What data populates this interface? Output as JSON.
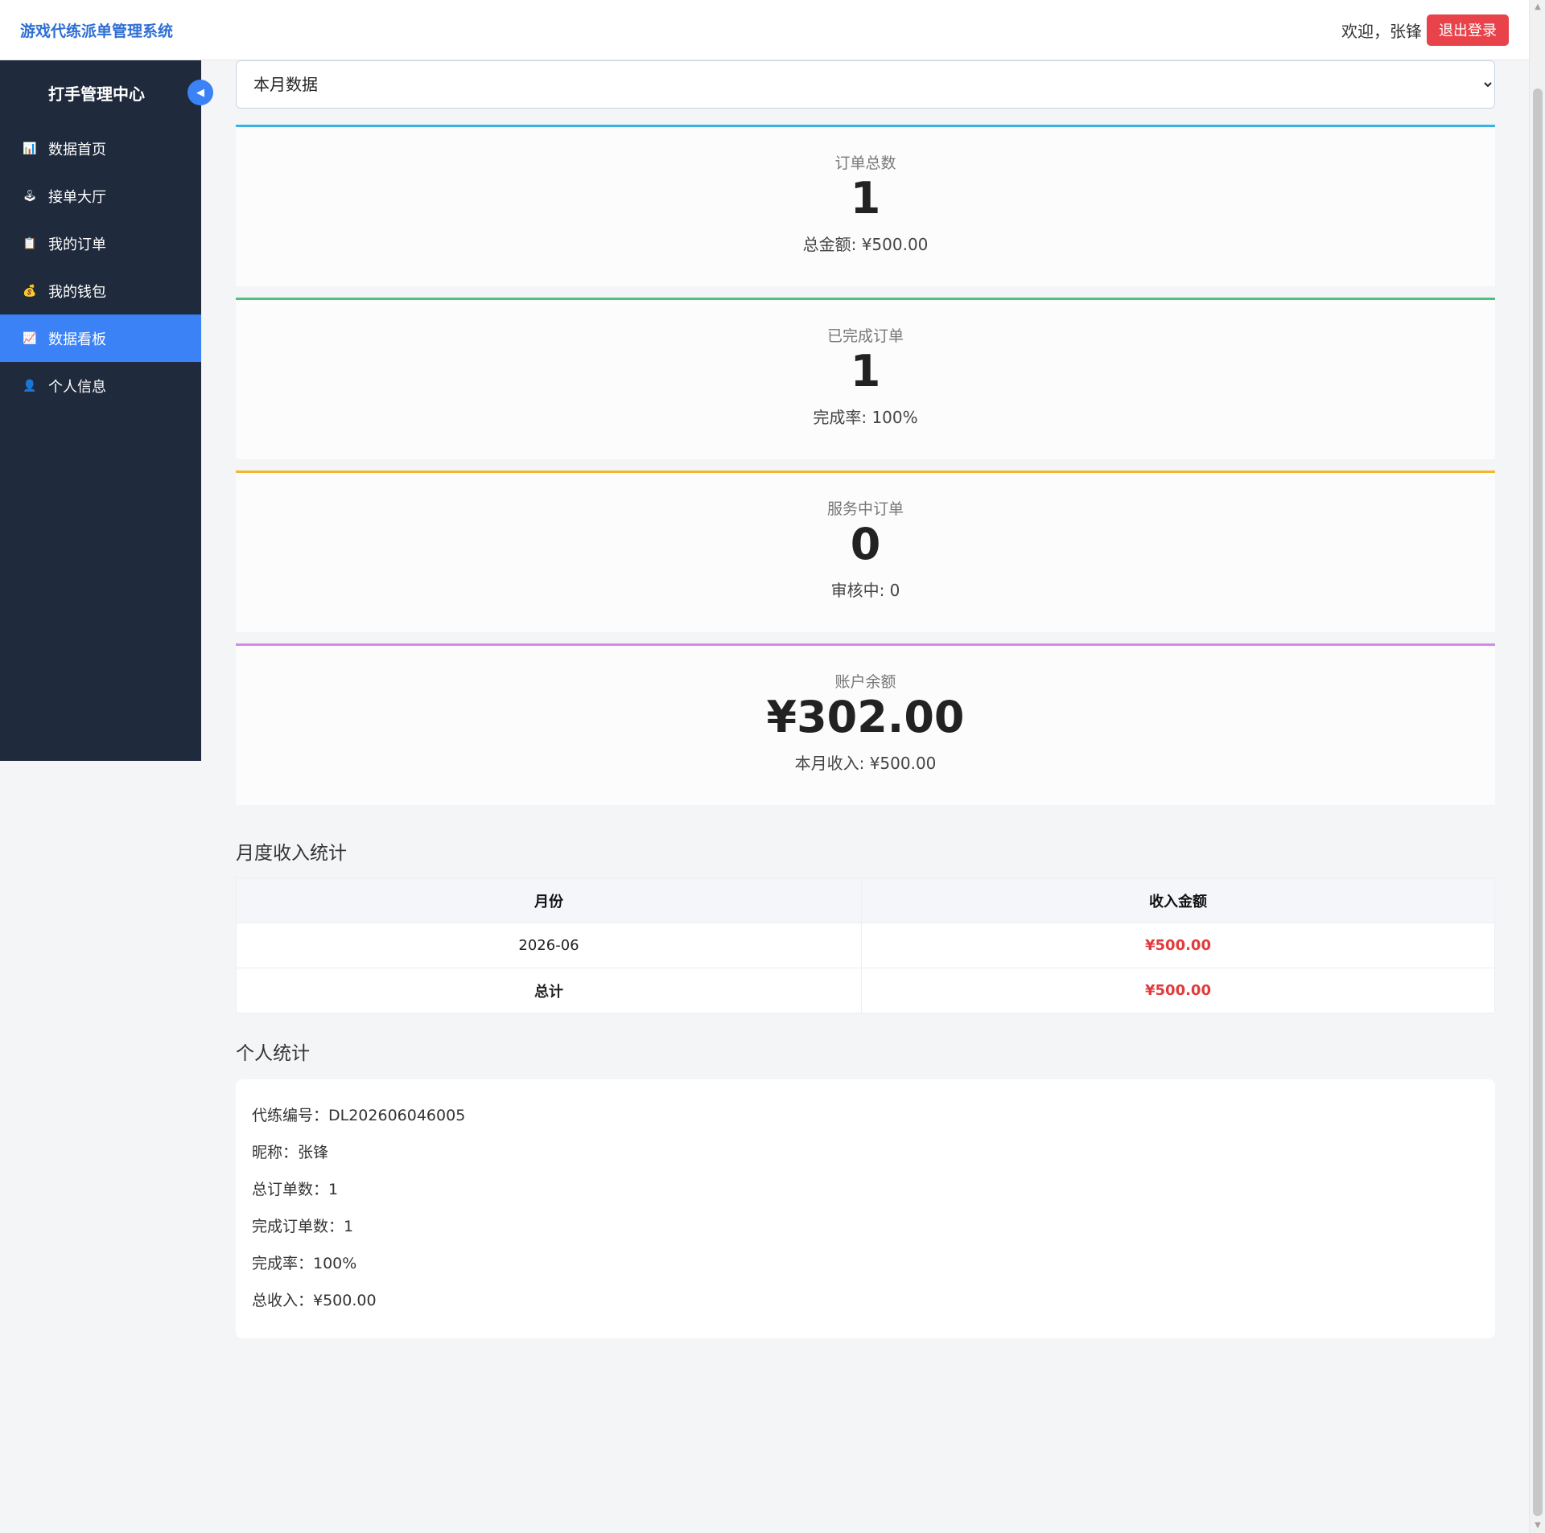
{
  "header": {
    "brand": "游戏代练派单管理系统",
    "welcome": "欢迎，张锋",
    "logout": "退出登录"
  },
  "sidebar": {
    "title": "打手管理中心",
    "collapse_icon": "◀",
    "items": [
      {
        "label": "数据首页",
        "icon": "bar-chart-icon",
        "glyph": "📊",
        "active": false
      },
      {
        "label": "接单大厅",
        "icon": "joystick-icon",
        "glyph": "🕹",
        "active": false
      },
      {
        "label": "我的订单",
        "icon": "clipboard-icon",
        "glyph": "📋",
        "active": false
      },
      {
        "label": "我的钱包",
        "icon": "money-bag-icon",
        "glyph": "💰",
        "active": false
      },
      {
        "label": "数据看板",
        "icon": "line-chart-icon",
        "glyph": "📈",
        "active": true
      },
      {
        "label": "个人信息",
        "icon": "user-icon",
        "glyph": "👤",
        "active": false
      }
    ]
  },
  "filter": {
    "selected": "本月数据"
  },
  "stats": [
    {
      "label": "订单总数",
      "value": "1",
      "sub": "总金额: ¥500.00",
      "color": "#38b3e0"
    },
    {
      "label": "已完成订单",
      "value": "1",
      "sub": "完成率: 100%",
      "color": "#4fc17e"
    },
    {
      "label": "服务中订单",
      "value": "0",
      "sub": "审核中: 0",
      "color": "#f0b731"
    },
    {
      "label": "账户余额",
      "value": "¥302.00",
      "sub": "本月收入: ¥500.00",
      "color": "#d48ae8"
    }
  ],
  "monthly": {
    "title": "月度收入统计",
    "headers": [
      "月份",
      "收入金额"
    ],
    "rows": [
      {
        "month": "2026-06",
        "amount": "¥500.00"
      }
    ],
    "total_label": "总计",
    "total_amount": "¥500.00"
  },
  "personal": {
    "title": "个人统计",
    "lines": [
      "代练编号：DL202606046005",
      "昵称：张锋",
      "总订单数：1",
      "完成订单数：1",
      "完成率：100%",
      "总收入：¥500.00"
    ]
  },
  "colors": {
    "accent": "#3b82f6",
    "sidebar_bg": "#1f2a3c",
    "danger": "#e8434a",
    "money": "#e23b3b"
  }
}
